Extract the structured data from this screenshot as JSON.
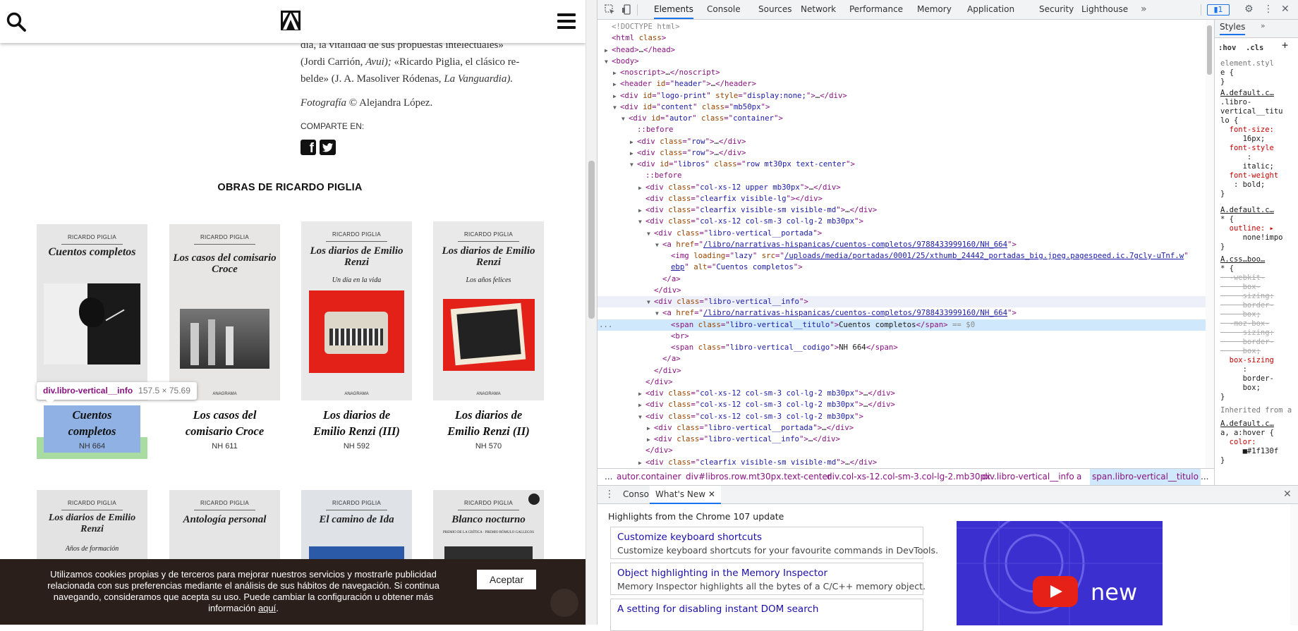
{
  "page": {
    "bio_lines": [
      {
        "pre": "día, la vitalidad de sus propuestas intelectuales»",
        "em": "",
        "post": ""
      },
      {
        "pre": "(Jordi Carrión, ",
        "em": "Avui);",
        "post": " «Ricardo Piglia, el clásico re-"
      },
      {
        "pre": "belde» (J. A. Masoliver Ródenas, ",
        "em": "La Vanguardia).",
        "post": ""
      }
    ],
    "photo_label": "Fotografía",
    "photo_credit": " © Alejandra López.",
    "share_label": "COMPARTE EN:",
    "works_heading": "OBRAS DE RICARDO PIGLIA",
    "books": [
      {
        "cover_author": "RICARDO PIGLIA",
        "cover_title": "Cuentos completos",
        "cover_sub": "",
        "title_line1": "Cuentos",
        "title_line2": "completos",
        "code": "NH 664"
      },
      {
        "cover_author": "RICARDO PIGLIA",
        "cover_title": "Los casos del comisario Croce",
        "cover_sub": "",
        "title_line1": "Los casos del",
        "title_line2": "comisario Croce",
        "code": "NH 611"
      },
      {
        "cover_author": "RICARDO PIGLIA",
        "cover_title": "Los diarios de Emilio Renzi",
        "cover_sub": "Un día en la vida",
        "title_line1": "Los diarios de",
        "title_line2": "Emilio Renzi (III)",
        "code": "NH 592"
      },
      {
        "cover_author": "RICARDO PIGLIA",
        "cover_title": "Los diarios de Emilio Renzi",
        "cover_sub": "Los años felices",
        "title_line1": "Los diarios de",
        "title_line2": "Emilio Renzi (II)",
        "code": "NH 570"
      }
    ],
    "books_row2": [
      {
        "cover_author": "RICARDO PIGLIA",
        "cover_title": "Los diarios de Emilio Renzi",
        "cover_sub": "Años de formación"
      },
      {
        "cover_author": "RICARDO PIGLIA",
        "cover_title": "Antología personal",
        "cover_sub": ""
      },
      {
        "cover_author": "RICARDO PIGLIA",
        "cover_title": "El camino de Ida",
        "cover_sub": ""
      },
      {
        "cover_author": "RICARDO PIGLIA",
        "cover_title": "Blanco nocturno",
        "cover_sub": "PREMIO DE LA CRÍTICA · PREMIO RÓMULO GALLEGOS"
      }
    ],
    "publisher": "ANAGRAMA",
    "tooltip_name": "div.libro-vertical__info",
    "tooltip_size": "157.5 × 75.69",
    "cookie_text": "Utilizamos cookies propias y de terceros para mejorar nuestros servicios y mostrarle publicidad relacionada con sus preferencias mediante el análisis de sus hábitos de navegación. Si continua navegando, consideramos que acepta su uso. Puede cambiar la configuración u obtener más información ",
    "cookie_link": "aquí",
    "cookie_end": ".",
    "cookie_button": "Aceptar"
  },
  "devtools": {
    "tabs": [
      "Elements",
      "Console",
      "Sources",
      "Network",
      "Performance",
      "Memory",
      "Application",
      "Security",
      "Lighthouse"
    ],
    "more": "»",
    "issues_badge": "1",
    "breadcrumbs": [
      "...",
      "autor.container",
      "div#libros.row.mt30px.text-center",
      "div.col-xs-12.col-sm-3.col-lg-2.mb30px",
      "div.libro-vertical__info",
      "a",
      "span.libro-vertical__titulo",
      "..."
    ],
    "styles_tab": "Styles",
    "styles_more": "»",
    "hov": ":hov",
    "cls": ".cls",
    "drawer_tabs": [
      "Console",
      "What's New"
    ],
    "highlights": "Highlights from the Chrome 107 update",
    "cards": [
      {
        "title": "Customize keyboard shortcuts",
        "desc": "Customize keyboard shortcuts for your favourite commands in DevTools."
      },
      {
        "title": "Object highlighting in the Memory Inspector",
        "desc": "Memory Inspector highlights all the bytes of a C/C++ memory object."
      },
      {
        "title": "A setting for disabling instant DOM search",
        "desc": ""
      }
    ],
    "video_text": "new"
  }
}
